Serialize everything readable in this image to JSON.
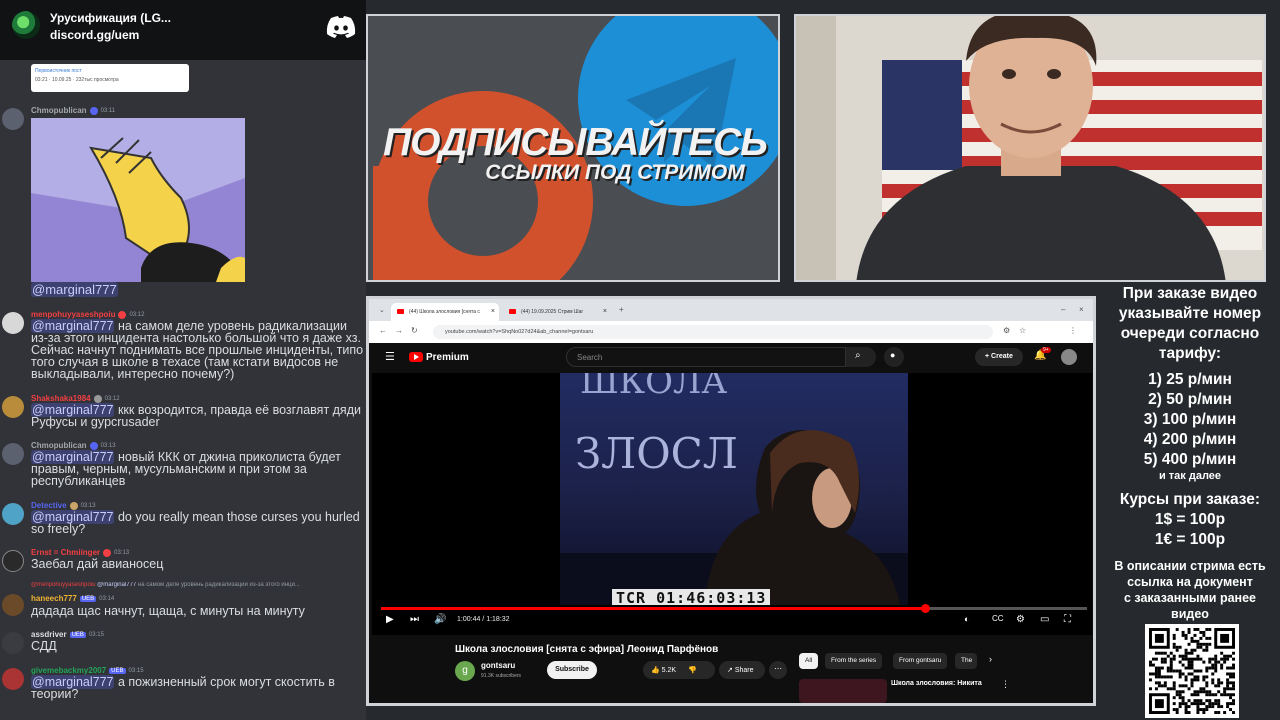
{
  "discord": {
    "server_name": "Урусификация (LG...",
    "invite": "discord.gg/uem",
    "embed": {
      "line1": "Первоисточник пост",
      "line2": "03:21 · 10.09.25 · 232тыс просмотра"
    },
    "messages": [
      {
        "username": "Chmopublican",
        "color": "#a3a6aa",
        "time": "03:11",
        "text": "@marginal777",
        "is_mention_only": true
      },
      {
        "username": "menpohuyyaseshpoiu",
        "color": "#f23f43",
        "time": "03:12",
        "mention": "@marginal777",
        "text": " на самом деле уровень радикализации из-за этого инцидента настолько большой что я даже хз. Сейчас начнут поднимать все прошлые инциденты, типо того случая в школе в техасе (там кстати видосов не выкладывали, интересно почему?)"
      },
      {
        "username": "Shakshaka1984",
        "color": "#f23f43",
        "time": "03:12",
        "mention": "@marginal777",
        "text": " ккк возродится, правда её возглавят дяди Руфусы и gypcrusader"
      },
      {
        "username": "Chmopublican",
        "color": "#a3a6aa",
        "time": "03:13",
        "mention": "@marginal777",
        "text": " новый ККК от джина приколиста будет правым, черным, мусульманским и при этом за республиканцев"
      },
      {
        "username": "Detective",
        "color": "#5865f2",
        "time": "03:13",
        "mention": "@marginal777",
        "text": " do you really mean those curses you hurled so freely?"
      },
      {
        "username": "Ernst = Chmiinger",
        "color": "#f23f43",
        "time": "03:13",
        "text": "Заебал дай авианосец"
      },
      {
        "username": "haneech777",
        "color": "#f0b232",
        "time": "03:14",
        "badge": "UEB",
        "reply_user": "@menpohuyyaseshpoiu",
        "reply_mention": "@marginal777",
        "reply_text": " на самом деле уровень радикализации из-за этого инци...",
        "text": "дадада щас начнут, щаща, с минуты на минуту"
      },
      {
        "username": "assdriver",
        "color": "#dbdee1",
        "time": "03:15",
        "badge": "UEB",
        "text": "СДД"
      },
      {
        "username": "givemebackmy2007",
        "color": "#23a559",
        "time": "03:15",
        "badge": "UEB",
        "mention": "@marginal777",
        "text": " а пожизненный срок могут скостить в теории?"
      }
    ]
  },
  "banner": {
    "title": "ПОДПИСЫВАЙТЕСЬ",
    "subtitle": "ССЫЛКИ ПОД СТРИМОМ"
  },
  "browser": {
    "tabs": [
      {
        "label": "(44) Школа злословия [снята с",
        "active": true
      },
      {
        "label": "(44) 19.09.2025 Стрим Шаг",
        "active": false
      }
    ],
    "url": "youtube.com/watch?v=ShqNo027d24&ab_channel=gontsaru"
  },
  "youtube": {
    "brand": "Premium",
    "search_placeholder": "Search",
    "create_label": "Create",
    "notif_count": "9+",
    "timecode": "TCR 01:46:03:13",
    "time_display": "1:00:44 / 1:18:32",
    "progress": 0.77,
    "video_title": "Школа злословия [снята с эфира] Леонид Парфёнов",
    "channel_initial": "g",
    "channel_name": "gontsaru",
    "subscribers": "91.3K subscribers",
    "subscribe_label": "Subscribe",
    "likes": "5.2K",
    "share_label": "Share",
    "chips": [
      "All",
      "From the series",
      "From gontsaru",
      "The"
    ],
    "rec_title": "Школа злословия: Никита"
  },
  "info": {
    "order_lines": [
      "При заказе видео",
      "указывайте номер",
      "очереди согласно",
      "тарифу:"
    ],
    "tariffs": [
      "1) 25 р/мин",
      "2) 50 р/мин",
      "3) 100 р/мин",
      "4) 200 р/мин",
      "5) 400 р/мин"
    ],
    "and_further": "и так далее",
    "courses_title": "Курсы при заказе:",
    "courses": [
      "1$ = 100р",
      "1€ = 100р"
    ],
    "desc_lines": [
      "В описании стрима есть",
      "ссылка на документ",
      "с заказанными ранее",
      "видео"
    ]
  }
}
